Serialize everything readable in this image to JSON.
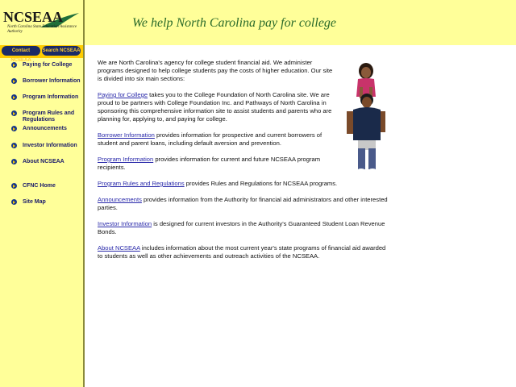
{
  "header": {
    "logo_text": "NCSEAA",
    "logo_subtitle": "North Carolina State Education Assistance Authority",
    "tagline": "We help North Carolina pay for college"
  },
  "top_buttons": [
    {
      "label": "Contact NCSEAA"
    },
    {
      "label": "Search NCSEAA"
    }
  ],
  "nav": {
    "items": [
      {
        "label": "Paying for College"
      },
      {
        "label": "Borrower Information"
      },
      {
        "label": "Program Information"
      },
      {
        "label": "Program Rules and Regulations"
      },
      {
        "label": "Announcements"
      },
      {
        "label": "Investor Information"
      },
      {
        "label": "About NCSEAA"
      },
      {
        "label": "CFNC Home"
      },
      {
        "label": "Site Map"
      }
    ]
  },
  "content": {
    "intro": "We are North Carolina's agency for college student financial aid. We administer programs designed to help college students pay the costs of higher education. Our site is divided into six main sections:",
    "sections": [
      {
        "link": "Paying for College",
        "text": " takes you to the College Foundation of North Carolina site. We are proud to be partners with College Foundation Inc. and Pathways of North Carolina in sponsoring this comprehensive information site to assist students and parents who are planning for, applying to, and paying for college."
      },
      {
        "link": "Borrower Information",
        "text": " provides information for prospective and current borrowers of student and parent loans, including default aversion and prevention."
      },
      {
        "link": "Program Information",
        "text": " provides information for current and future NCSEAA program recipients."
      },
      {
        "link": "Program Rules and Regulations",
        "text": " provides Rules and Regulations for NCSEAA programs."
      },
      {
        "link": "Announcements",
        "text": " provides information from the Authority for financial aid administrators and other interested parties."
      },
      {
        "link": "Investor Information",
        "text": " is designed for current investors in the Authority's Guaranteed Student Loan Revenue Bonds."
      },
      {
        "link": "About NCSEAA",
        "text": " includes information about the most current year's state programs of financial aid awarded to students as well as other achievements and outreach activities of the NCSEAA."
      }
    ]
  },
  "colors": {
    "background_band": "#ffff99",
    "nav_text": "#1a1a6a",
    "link": "#2a2aaa",
    "tagline": "#2a6a2a",
    "button_bg": "#1a2a66",
    "button_text": "#ffcc33"
  }
}
